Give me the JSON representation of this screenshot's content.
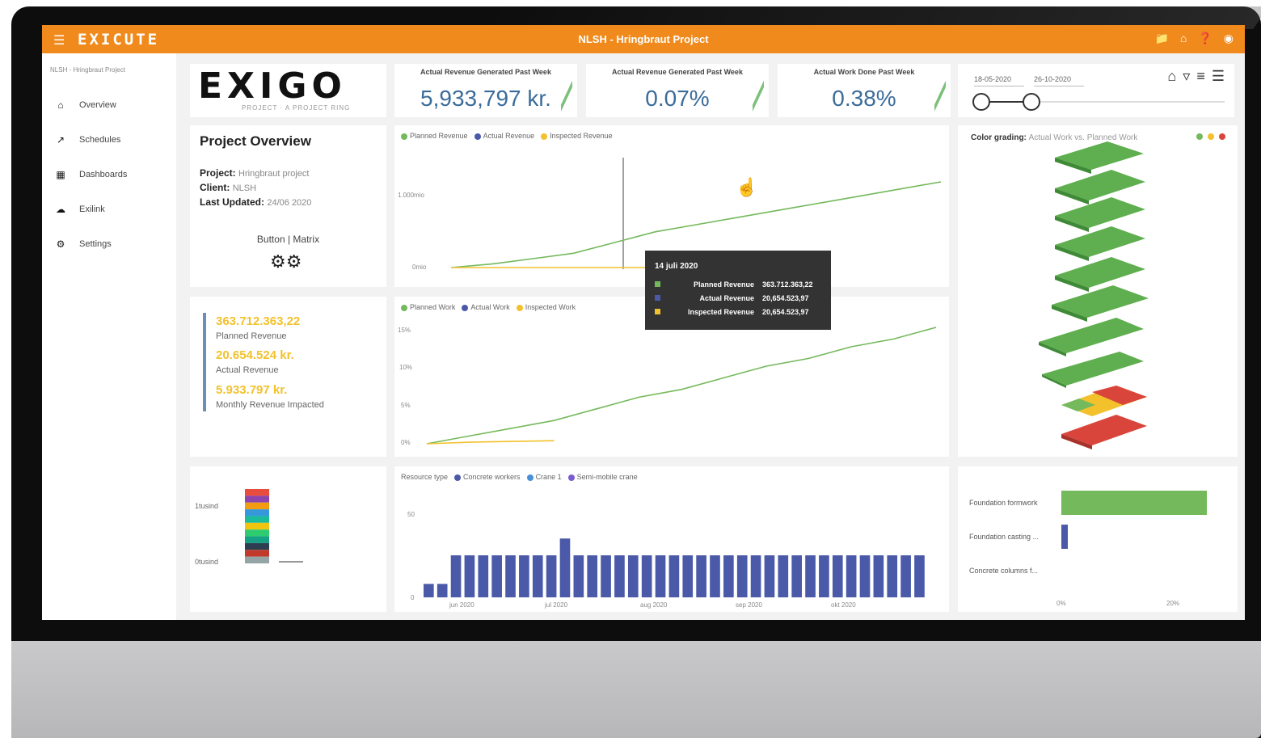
{
  "app": {
    "brand": "EXICUTE",
    "title": "NLSH - Hringbraut Project"
  },
  "sidebar": {
    "breadcrumb": "NLSH - Hringbraut Project",
    "items": [
      {
        "label": "Overview",
        "icon": "home-icon"
      },
      {
        "label": "Schedules",
        "icon": "trend-icon"
      },
      {
        "label": "Dashboards",
        "icon": "dashboard-icon"
      },
      {
        "label": "Exilink",
        "icon": "cloud-icon"
      },
      {
        "label": "Settings",
        "icon": "gear-icon"
      }
    ]
  },
  "logo": {
    "text": "EXIGO",
    "sub": "PROJECT · A PROJECT RING"
  },
  "kpis": [
    {
      "label": "Actual Revenue Generated Past Week",
      "value": "5,933,797 kr."
    },
    {
      "label": "Actual Revenue Generated Past Week",
      "value": "0.07%"
    },
    {
      "label": "Actual Work Done Past Week",
      "value": "0.38%"
    }
  ],
  "filters": {
    "date_from": "18-05-2020",
    "date_to": "26-10-2020"
  },
  "project_overview": {
    "title": "Project Overview",
    "project_label": "Project:",
    "project_value": "Hringbraut project",
    "client_label": "Client:",
    "client_value": "NLSH",
    "updated_label": "Last Updated:",
    "updated_value": "24/06 2020",
    "button_label": "Button | Matrix"
  },
  "revenue_summary": [
    {
      "value": "363.712.363,22",
      "label": "Planned Revenue"
    },
    {
      "value": "20.654.524 kr.",
      "label": "Actual Revenue"
    },
    {
      "value": "5.933.797 kr.",
      "label": "Monthly Revenue Impacted"
    }
  ],
  "colors": {
    "accent": "#f08a1c",
    "green": "#74b95c",
    "blue": "#4a5aa8",
    "yellow": "#f3c12b",
    "red": "#d9453a"
  },
  "tooltip": {
    "title": "14 juli 2020",
    "rows": [
      {
        "label": "Planned Revenue",
        "value": "363.712.363,22",
        "color": "#74b95c"
      },
      {
        "label": "Actual Revenue",
        "value": "20,654.523,97",
        "color": "#4a5aa8"
      },
      {
        "label": "Inspected Revenue",
        "value": "20,654.523,97",
        "color": "#f3c12b"
      }
    ]
  },
  "building": {
    "title": "Color grading:",
    "subtitle": "Actual Work vs. Planned Work"
  },
  "bar_chart_right": {
    "categories": [
      "Foundation formwork",
      "Foundation casting ...",
      "Concrete columns f..."
    ],
    "x_ticks": [
      "0%",
      "20%"
    ]
  },
  "chart_data": [
    {
      "type": "line",
      "series": [
        {
          "name": "Planned Revenue",
          "color": "#74b95c",
          "values": [
            0,
            2,
            5,
            8,
            14,
            20,
            24,
            28,
            32,
            36,
            40,
            44,
            48
          ]
        },
        {
          "name": "Actual Revenue",
          "color": "#4a5aa8",
          "values": []
        },
        {
          "name": "Inspected Revenue",
          "color": "#f3c12b",
          "values": [
            0,
            0,
            0,
            0,
            0,
            0,
            null,
            null,
            null,
            null,
            null,
            null,
            null
          ]
        }
      ],
      "yticks": [
        "0mio",
        "1.000mio"
      ]
    },
    {
      "type": "line",
      "series": [
        {
          "name": "Planned Work",
          "color": "#74b95c",
          "values": [
            0,
            1,
            2,
            3,
            4.5,
            6,
            7,
            8.5,
            10,
            11,
            12.5,
            13.5,
            15
          ]
        },
        {
          "name": "Actual Work",
          "color": "#4a5aa8",
          "values": []
        },
        {
          "name": "Inspected Work",
          "color": "#f3c12b",
          "values": [
            0,
            0.2,
            0.3,
            0.4,
            null,
            null,
            null,
            null,
            null,
            null,
            null,
            null,
            null
          ]
        }
      ],
      "yticks": [
        "0%",
        "5%",
        "10%",
        "15%"
      ]
    },
    {
      "type": "bar",
      "title": "Resource type",
      "legend": [
        "Concrete workers",
        "Crane 1",
        "Semi-mobile crane"
      ],
      "values": [
        8,
        8,
        25,
        25,
        25,
        25,
        25,
        25,
        25,
        25,
        35,
        25,
        25,
        25,
        25,
        25,
        25,
        25,
        25,
        25,
        25,
        25,
        25,
        25,
        25,
        25,
        25,
        25,
        25,
        25,
        25,
        25,
        25,
        25,
        25,
        25,
        25
      ],
      "ylim": [
        0,
        50
      ],
      "yticks": [
        "50",
        "0"
      ],
      "xticks": [
        "jun 2020",
        "jul 2020",
        "aug 2020",
        "sep 2020",
        "okt 2020"
      ]
    },
    {
      "type": "bar",
      "categories": [
        "Foundation formwork",
        "Foundation casting ...",
        "Concrete columns f..."
      ],
      "values": [
        24,
        1,
        0
      ],
      "xticks": [
        "0%",
        "20%"
      ]
    },
    {
      "type": "bar",
      "yticks": [
        "1tusind",
        "0tusind"
      ],
      "stacked_colors": [
        "#e84c3d",
        "#8e44ad",
        "#f39c12",
        "#3498db",
        "#1abc9c",
        "#f1c40f",
        "#2ecc71",
        "#16a085",
        "#2c3e50",
        "#c0392b",
        "#95a5a6"
      ],
      "values": [
        100,
        2,
        0,
        0
      ]
    }
  ]
}
